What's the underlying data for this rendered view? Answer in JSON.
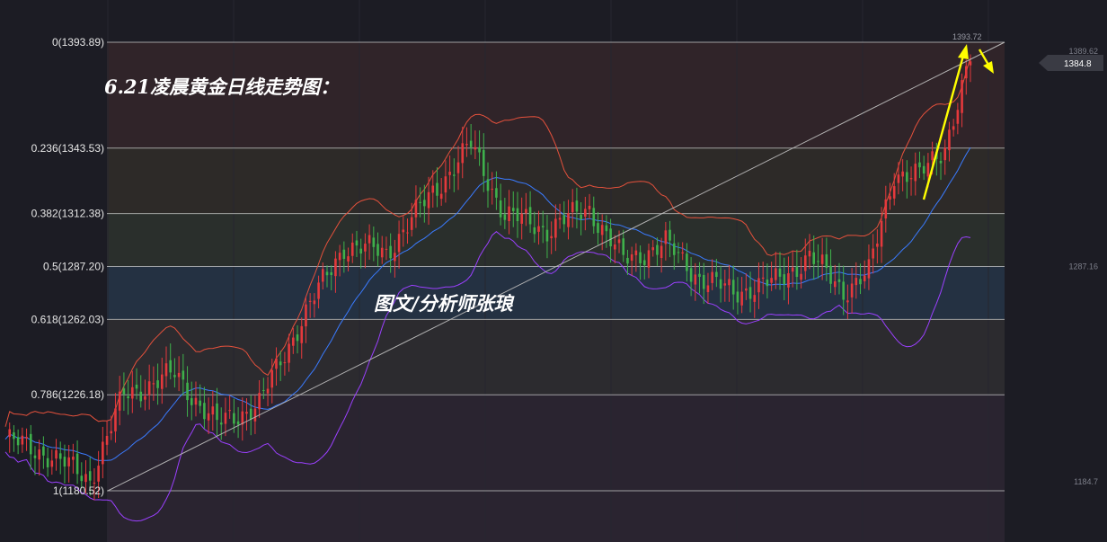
{
  "title": "6.21凌晨黄金日线走势图：",
  "watermark": "图文/分析师张琅",
  "colors": {
    "background": "#1c1c24",
    "up_candle": "#e5393c",
    "down_candle": "#3fb14b",
    "upper_band": "#e5513c",
    "middle_band": "#3a7bff",
    "lower_band": "#9b40ff",
    "trend_line": "#b8b8b8",
    "arrow": "#ffff00",
    "level_line": "#c8c8c8"
  },
  "icons": [
    "up-arrow-icon",
    "down-arrow-icon"
  ],
  "chart_data": {
    "type": "candlestick",
    "indicator": "Fibonacci retracement + Bollinger Bands",
    "fib_levels": [
      {
        "label": "0(1393.89)",
        "ratio": 0,
        "price": 1393.89
      },
      {
        "label": "0.236(1343.53)",
        "ratio": 0.236,
        "price": 1343.53
      },
      {
        "label": "0.382(1312.38)",
        "ratio": 0.382,
        "price": 1312.38
      },
      {
        "label": "0.5(1287.20)",
        "ratio": 0.5,
        "price": 1287.2
      },
      {
        "label": "0.618(1262.03)",
        "ratio": 0.618,
        "price": 1262.03
      },
      {
        "label": "0.786(1226.18)",
        "ratio": 0.786,
        "price": 1226.18
      },
      {
        "label": "1(1180.52)",
        "ratio": 1,
        "price": 1180.52
      }
    ],
    "right_axis_ticks": [
      1389.62,
      1287.16,
      1184.7
    ],
    "peak_label": "1393.72",
    "current_price": "1384.8",
    "trend_line": [
      {
        "x": "first",
        "y": 1180.52
      },
      {
        "x": "last",
        "y": 1393.89
      }
    ],
    "key_points": [
      {
        "i": 0,
        "close": 1205
      },
      {
        "i": 10,
        "close": 1198
      },
      {
        "i": 20,
        "close": 1186
      },
      {
        "i": 28,
        "close": 1226
      },
      {
        "i": 40,
        "close": 1236
      },
      {
        "i": 50,
        "close": 1212
      },
      {
        "i": 60,
        "close": 1222
      },
      {
        "i": 70,
        "close": 1262
      },
      {
        "i": 80,
        "close": 1297
      },
      {
        "i": 90,
        "close": 1294
      },
      {
        "i": 100,
        "close": 1320
      },
      {
        "i": 110,
        "close": 1345
      },
      {
        "i": 118,
        "close": 1312
      },
      {
        "i": 128,
        "close": 1305
      },
      {
        "i": 138,
        "close": 1315
      },
      {
        "i": 146,
        "close": 1290
      },
      {
        "i": 156,
        "close": 1298
      },
      {
        "i": 164,
        "close": 1282
      },
      {
        "i": 172,
        "close": 1275
      },
      {
        "i": 182,
        "close": 1280
      },
      {
        "i": 190,
        "close": 1292
      },
      {
        "i": 198,
        "close": 1276
      },
      {
        "i": 204,
        "close": 1284
      },
      {
        "i": 210,
        "close": 1332
      },
      {
        "i": 216,
        "close": 1330
      },
      {
        "i": 222,
        "close": 1345
      },
      {
        "i": 228,
        "close": 1384.8
      }
    ]
  }
}
